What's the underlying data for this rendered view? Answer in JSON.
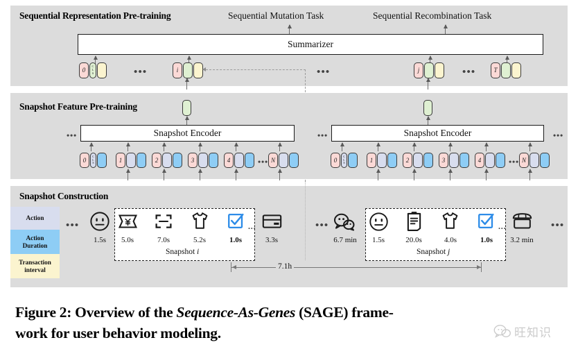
{
  "figure": {
    "caption_prefix": "Figure 2: Overview of the ",
    "caption_italic": "Sequence-As-Genes",
    "caption_suffix": " (SAGE) frame-work for user behavior modeling.",
    "caption_line1_a": "Figure 2: Overview of the ",
    "caption_line1_b": "Sequence-As-Genes",
    "caption_line1_c": " (SAGE) frame-",
    "caption_line2": "work for user behavior modeling."
  },
  "watermark": {
    "text": "旺知识",
    "icon": "chat-bubble-icon"
  },
  "panels": {
    "sequential": {
      "title": "Sequential Representation Pre-training",
      "tasks": [
        {
          "label": "Sequential Mutation Task"
        },
        {
          "label": "Sequential Recombination Task"
        }
      ],
      "summarizer": {
        "label": "Summarizer"
      },
      "token_groups": [
        {
          "index": "0",
          "cls": "CLS"
        },
        {
          "index": "i",
          "cls": ""
        },
        {
          "index": "j",
          "cls": ""
        },
        {
          "index": "T",
          "cls": ""
        }
      ],
      "ellipses": [
        "•••",
        "•••",
        "•••"
      ]
    },
    "snapshot_feature": {
      "title": "Snapshot Feature Pre-training",
      "encoders": [
        {
          "label": "Snapshot Encoder"
        },
        {
          "label": "Snapshot Encoder"
        }
      ],
      "token_rows": [
        {
          "cls_group": {
            "index": "0",
            "cls": "CLS"
          },
          "items": [
            "1",
            "2",
            "3",
            "4",
            "N"
          ],
          "ellipsis": "•••"
        },
        {
          "cls_group": {
            "index": "0",
            "cls": "CLS"
          },
          "items": [
            "1",
            "2",
            "3",
            "4",
            "N"
          ],
          "ellipsis": "•••"
        }
      ],
      "side_ellipsis_left": "•••",
      "side_ellipsis_right": "•••"
    },
    "snapshot_construction": {
      "title": "Snapshot Construction",
      "legend": [
        {
          "label": "Action",
          "color": "#d8ddee"
        },
        {
          "label": "Action\nDuration",
          "color": "#8ecdf5",
          "line1": "Action",
          "line2": "Duration"
        },
        {
          "label": "Transaction\ninterval",
          "color": "#fbf4cf",
          "line1": "Transaction",
          "line2": "interval"
        }
      ],
      "left_lead": {
        "icon": "smiley-icon",
        "duration": "1.5s"
      },
      "left_ellipsis": "•••",
      "snapshot_i": {
        "caption_prefix": "Snapshot ",
        "caption_index": "i",
        "actions": [
          {
            "icon": "coupon-yen-icon",
            "duration": "5.0s",
            "bold": false
          },
          {
            "icon": "scan-frame-icon",
            "duration": "7.0s",
            "bold": false
          },
          {
            "icon": "tshirt-icon",
            "duration": "5.2s",
            "bold": false
          },
          {
            "icon": "checkbox-checked-icon",
            "duration": "1.0s",
            "bold": true
          },
          {
            "icon": "credit-card-icon",
            "duration": "3.3s",
            "bold": false
          }
        ],
        "inner_ellipsis": "..."
      },
      "mid_lead": {
        "icon": "wechat-bubbles-icon",
        "duration": "6.7 min"
      },
      "mid_ellipsis": "•••",
      "snapshot_j": {
        "caption_prefix": "Snapshot ",
        "caption_index": "j",
        "actions": [
          {
            "icon": "smiley-icon",
            "duration": "1.5s",
            "bold": false
          },
          {
            "icon": "clipboard-icon",
            "duration": "20.0s",
            "bold": false
          },
          {
            "icon": "tshirt-icon",
            "duration": "4.0s",
            "bold": false
          },
          {
            "icon": "checkbox-checked-icon",
            "duration": "1.0s",
            "bold": true
          },
          {
            "icon": "storefront-icon",
            "duration": "3.2 min",
            "bold": false
          }
        ],
        "inner_ellipsis": "..."
      },
      "right_ellipsis": "•••",
      "timeline": {
        "label": "7.1h"
      }
    }
  },
  "colors": {
    "panel_bg": "#dcdcdc",
    "token_index": "#fbd9d6",
    "token_green": "#dff0d2",
    "token_yellow": "#fbf4cf",
    "token_lavender": "#d8ddee",
    "token_blue": "#8ecdf5",
    "accent_blue": "#2d8ce8",
    "stroke": "#1a1a1a"
  }
}
